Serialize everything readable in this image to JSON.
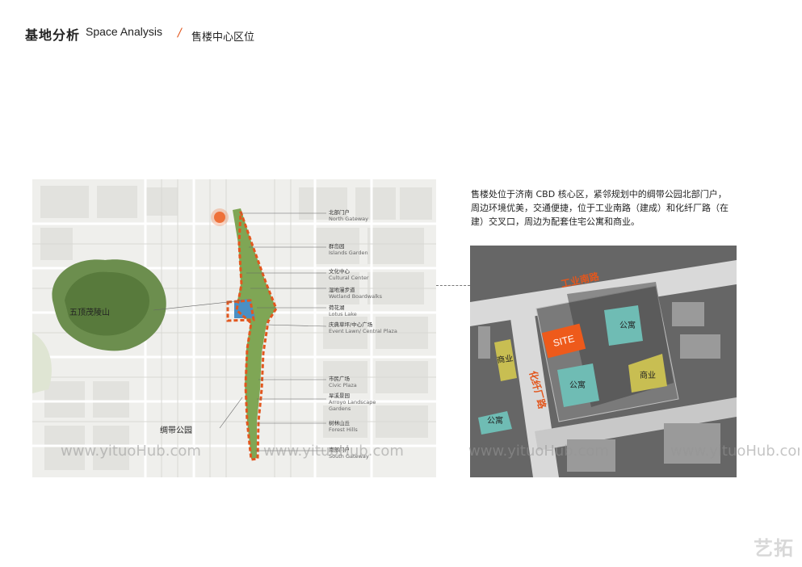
{
  "header": {
    "title_cn": "基地分析",
    "title_en": "Space Analysis",
    "subtitle": "售楼中心区位"
  },
  "description": [
    "售楼处位于济南 CBD 核心区，紧邻规划中的绸带公园北部门户，",
    "周边环境优美，交通便捷，位于工业南路（建成）和化纤厂路（在",
    "建）交叉口，周边为配套住宅公寓和商业。"
  ],
  "left_map": {
    "mountain_label": "五顶茂陵山",
    "park_label": "绸带公园",
    "legend": [
      {
        "cn": "北部门户",
        "en": "North Gateway"
      },
      {
        "cn": "群岛园",
        "en": "Islands Garden"
      },
      {
        "cn": "文化中心",
        "en": "Cultural Center"
      },
      {
        "cn": "湿地漫步道",
        "en": "Wetland Boardwalks"
      },
      {
        "cn": "荷花湖",
        "en": "Lotus Lake"
      },
      {
        "cn": "庆典草坪/中心广场",
        "en": "Event Lawn/ Central Plaza"
      },
      {
        "cn": "市民广场",
        "en": "Civic Plaza"
      },
      {
        "cn": "旱溪景园",
        "en": "Arroyo Landscape Gardens"
      },
      {
        "cn": "树林山丘",
        "en": "Forest Hills"
      },
      {
        "cn": "南部门户",
        "en": "South Gateway"
      }
    ]
  },
  "right_map": {
    "road_1": "工业南路",
    "road_2": "化纤厂路",
    "site_label": "SITE",
    "apartment": "公寓",
    "commercial": "商业"
  },
  "watermarks": {
    "url": "www.yituoHub.com",
    "logo": "艺拓"
  },
  "colors": {
    "accent_orange": "#ee5a1b",
    "apartment_teal": "#6fbcb4",
    "commercial_olive": "#c8be52"
  }
}
